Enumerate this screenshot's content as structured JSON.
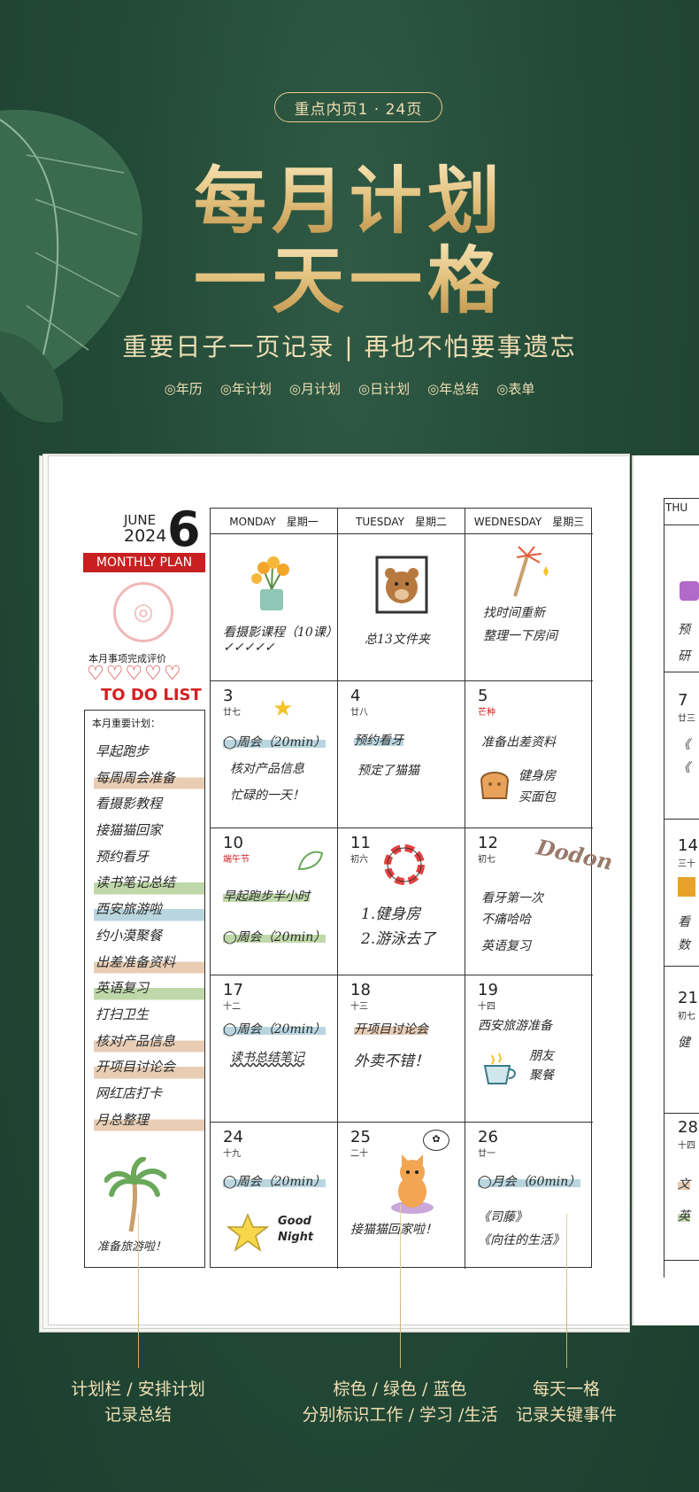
{
  "badge": "重点内页1 · 24页",
  "title_line1": "每月计划",
  "title_line2": "一天一格",
  "subtitle": "重要日子一页记录 | 再也不怕要事遗忘",
  "features": [
    "年历",
    "年计划",
    "月计划",
    "日计划",
    "年总结",
    "表单"
  ],
  "planner": {
    "month_name": "JUNE",
    "year": "2024",
    "month_num": "6",
    "monthly_plan": "MONTHLY PLAN",
    "eval_label": "本月事项完成评价",
    "hearts": "♡♡♡♡♡",
    "todo": "TO DO LIST",
    "plan_heading": "本月重要计划：",
    "plan_items": [
      {
        "text": "早起跑步",
        "hl": ""
      },
      {
        "text": "每周周会准备",
        "hl": "b"
      },
      {
        "text": "看摄影教程",
        "hl": ""
      },
      {
        "text": "接猫猫回家",
        "hl": ""
      },
      {
        "text": "预约看牙",
        "hl": ""
      },
      {
        "text": "读书笔记总结",
        "hl": "g"
      },
      {
        "text": "西安旅游啦",
        "hl": "bl"
      },
      {
        "text": "约小漠聚餐",
        "hl": ""
      },
      {
        "text": "出差准备资料",
        "hl": "b"
      },
      {
        "text": "英语复习",
        "hl": "g"
      },
      {
        "text": "打扫卫生",
        "hl": ""
      },
      {
        "text": "核对产品信息",
        "hl": "b"
      },
      {
        "text": "开项目讨论会",
        "hl": "b"
      },
      {
        "text": "网红店打卡",
        "hl": ""
      },
      {
        "text": "月总整理",
        "hl": "b"
      }
    ],
    "palm_note": "准备旅游啦！",
    "col_heads": [
      "MONDAY　星期一",
      "TUESDAY　星期二",
      "WEDNESDAY　星期三"
    ],
    "thursday_head": "THU",
    "cells": [
      {
        "num": "",
        "lunar": "",
        "red": false,
        "lines": [
          "看摄影课程（10课）",
          "✓✓✓✓✓"
        ]
      },
      {
        "num": "",
        "lunar": "",
        "red": false,
        "lines": [
          "总13文件夹"
        ]
      },
      {
        "num": "",
        "lunar": "",
        "red": false,
        "lines": [
          "找时间重新",
          "整理一下房间"
        ]
      },
      {
        "num": "3",
        "lunar": "廿七",
        "red": false,
        "lines": [
          "◯周会（20min）",
          "核对产品信息",
          "忙碌的一天！"
        ]
      },
      {
        "num": "4",
        "lunar": "廿八",
        "red": false,
        "lines": [
          "预约看牙",
          "预定了猫猫"
        ]
      },
      {
        "num": "5",
        "lunar": "芒种",
        "red": true,
        "lines": [
          "准备出差资料",
          "健身房",
          "买面包"
        ]
      },
      {
        "num": "10",
        "lunar": "端午节",
        "red": true,
        "lines": [
          "早起跑步半小时",
          "◯周会（20min）"
        ]
      },
      {
        "num": "11",
        "lunar": "初六",
        "red": false,
        "lines": [
          "1.健身房",
          "2.游泳去了"
        ]
      },
      {
        "num": "12",
        "lunar": "初七",
        "red": false,
        "lines": [
          "看牙第一次",
          "不痛哈哈",
          "英语复习"
        ]
      },
      {
        "num": "17",
        "lunar": "十二",
        "red": false,
        "lines": [
          "◯周会（20min）",
          "读书总结笔记"
        ]
      },
      {
        "num": "18",
        "lunar": "十三",
        "red": false,
        "lines": [
          "开项目讨论会",
          "外卖不错！"
        ]
      },
      {
        "num": "19",
        "lunar": "十四",
        "red": false,
        "lines": [
          "西安旅游准备",
          "朋友",
          "聚餐"
        ]
      },
      {
        "num": "24",
        "lunar": "十九",
        "red": false,
        "lines": [
          "◯周会（20min）",
          "Good",
          "Night"
        ]
      },
      {
        "num": "25",
        "lunar": "二十",
        "red": false,
        "lines": [
          "接猫猫回家啦！"
        ]
      },
      {
        "num": "26",
        "lunar": "廿一",
        "red": false,
        "lines": [
          "◯月会（60min）",
          "《司藤》",
          "《向往的生活》"
        ]
      }
    ],
    "dodon": "Dodon",
    "right_nums": [
      {
        "num": "7",
        "lunar": "廿三"
      },
      {
        "num": "14",
        "lunar": "三十"
      },
      {
        "num": "21",
        "lunar": "初七"
      },
      {
        "num": "28",
        "lunar": "十四"
      }
    ],
    "right_snips": [
      "预",
      "研",
      "《",
      "《",
      "看",
      "数",
      "健",
      "文",
      "英"
    ]
  },
  "captions": [
    {
      "l1": "计划栏 / 安排计划",
      "l2": "记录总结"
    },
    {
      "l1": "棕色 / 绿色 / 蓝色",
      "l2": "分别标识工作 / 学习 /生活"
    },
    {
      "l1": "每天一格",
      "l2": "记录关键事件"
    }
  ],
  "colors": {
    "bg": "#234a37",
    "gold": "#e2c07c",
    "red": "#c82020",
    "hl_brown": "#e8cdb4",
    "hl_green": "#bfd8a9",
    "hl_blue": "#b9d6df"
  }
}
